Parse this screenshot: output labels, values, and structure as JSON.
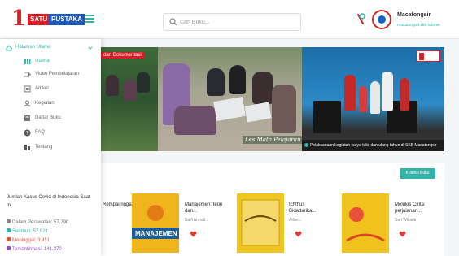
{
  "header": {
    "logo_number": "1",
    "logo_word_1": "SATU",
    "logo_word_2": "PUSTAKA",
    "search_placeholder": "Cari Buku...",
    "org_name": "Macatongsir",
    "org_subtitle": "macatongsir.skb.rabove",
    "accent_color": "#36b3a8",
    "brand_red": "#d81f26",
    "brand_blue": "#1e58b8"
  },
  "sidebar": {
    "section_label": "Halaman Utama",
    "items": [
      {
        "label": "Utama",
        "icon": "library-icon",
        "active": true
      },
      {
        "label": "Video Pembelajaran",
        "icon": "video-icon",
        "active": false
      },
      {
        "label": "Artikel",
        "icon": "article-icon",
        "active": false
      },
      {
        "label": "Kegiatan",
        "icon": "activity-icon",
        "active": false
      },
      {
        "label": "Daftar Buku",
        "icon": "book-list-icon",
        "active": false
      },
      {
        "label": "FAQ",
        "icon": "help-icon",
        "active": false
      },
      {
        "label": "Tentang",
        "icon": "info-icon",
        "active": false
      }
    ],
    "covid": {
      "title": "Jumlah Kasus Covid di Indonesia Saat Ini",
      "rows": [
        {
          "label": "Dalam Perawatan: 57,790",
          "color": "#888888"
        },
        {
          "label": "Sembuh: 57,921",
          "color": "#36b3a8"
        },
        {
          "label": "Meninggal: 3,951",
          "color": "#e0533a"
        },
        {
          "label": "Terkonfirmasi: 141,370",
          "color": "#8a4fbf"
        }
      ]
    }
  },
  "slider": {
    "left_label": "dan Dokumentasi",
    "center_caption": "Les Mata Pelajaran",
    "right_caption": "Pelaksanaan kegiatan karya tulis dan ulang tahun di SKB Macatongsir"
  },
  "books": {
    "more_label": "Koleksi Buku",
    "items": [
      {
        "title": "Rempai ngga...",
        "author": "",
        "cover": "cov-1"
      },
      {
        "title": "Manajemen: teori dan...",
        "author": "Saifi Ahmat...",
        "cover": "cov-2"
      },
      {
        "title": "Ichthus Bidadarika...",
        "author": "Alfan...",
        "cover": "cov-3"
      },
      {
        "title": "Melukis Cinta: perjalanan...",
        "author": "Sari Wilianti",
        "cover": "cov-4"
      }
    ],
    "manajemen_cover_text": "MANAJEMEN"
  }
}
